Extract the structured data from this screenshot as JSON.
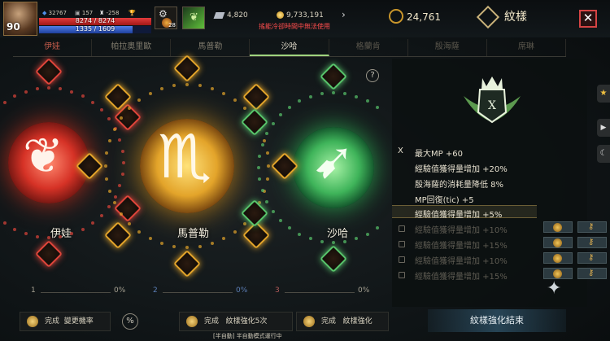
{
  "hud": {
    "level": "90",
    "stat_a": "32767",
    "stat_b": "157",
    "stat_c": "-258",
    "hp": {
      "text": "8274 / 8274",
      "fraction": 1.0
    },
    "mp": {
      "text": "1335 / 1609",
      "fraction": 0.83
    },
    "slot_count": "28",
    "gems": "4,820",
    "gold": "9,733,191",
    "notice": "搖能冷卻時間中無法使用",
    "honor": "24,761",
    "title": "紋樣",
    "close_label": "✕"
  },
  "tabs": [
    "伊娃",
    "帕拉奧里歐",
    "馬普勒",
    "沙哈",
    "格蘭肯",
    "殷海薩",
    "席琳"
  ],
  "emblems": [
    {
      "name": "伊娃",
      "color": "#e0453a"
    },
    {
      "name": "馬普勒",
      "color": "#e3a42a"
    },
    {
      "name": "沙哈",
      "color": "#58c46b"
    }
  ],
  "progress": [
    {
      "index": "1",
      "percent": "0%"
    },
    {
      "index": "2",
      "percent": "0%"
    },
    {
      "index": "3",
      "percent": "0%"
    }
  ],
  "help_label": "?",
  "buttons": {
    "change_rate": {
      "status": "完成",
      "label": "變更機率"
    },
    "percent_icon": "%",
    "enhance5": {
      "status": "完成",
      "label": "紋樣強化5次"
    },
    "enhance": {
      "status": "完成",
      "label": "紋樣強化"
    },
    "finish": "紋樣強化結束"
  },
  "bottom_hint": "[半自動] 半自動模式運行中",
  "panel": {
    "mark": "X",
    "stats": [
      "最大MP +60",
      "經驗值獲得量增加 +20%",
      "殷海薩的消耗量降低 8%",
      "MP回復(tic) +5",
      "經驗值獲得量增加 +5%"
    ],
    "locked_stats": [
      "經驗值獲得量增加 +10%",
      "經驗值獲得量增加 +15%",
      "經驗值獲得量增加 +10%",
      "經驗值獲得量增加 +15%"
    ]
  },
  "colors": {
    "red": "#e0453a",
    "gold": "#e3a42a",
    "green": "#58c46b",
    "accent": "#c9a252"
  }
}
